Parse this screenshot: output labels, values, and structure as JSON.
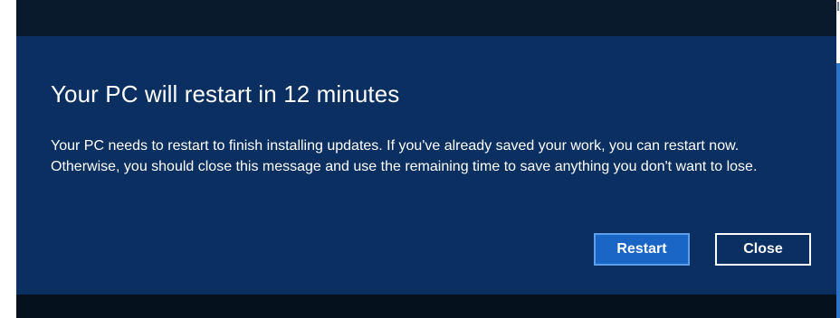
{
  "dialog": {
    "title": "Your PC will restart in 12 minutes",
    "message": "Your PC needs to restart to finish installing updates. If you've already saved your work, you can restart now. Otherwise, you should close this message and use the remaining time to save anything you don't want to lose.",
    "buttons": {
      "restart_label": "Restart",
      "close_label": "Close"
    }
  },
  "colors": {
    "dialog_background": "#0a2f60",
    "primary_button": "#1966c7",
    "text": "#ffffff",
    "backdrop": "#071526"
  }
}
